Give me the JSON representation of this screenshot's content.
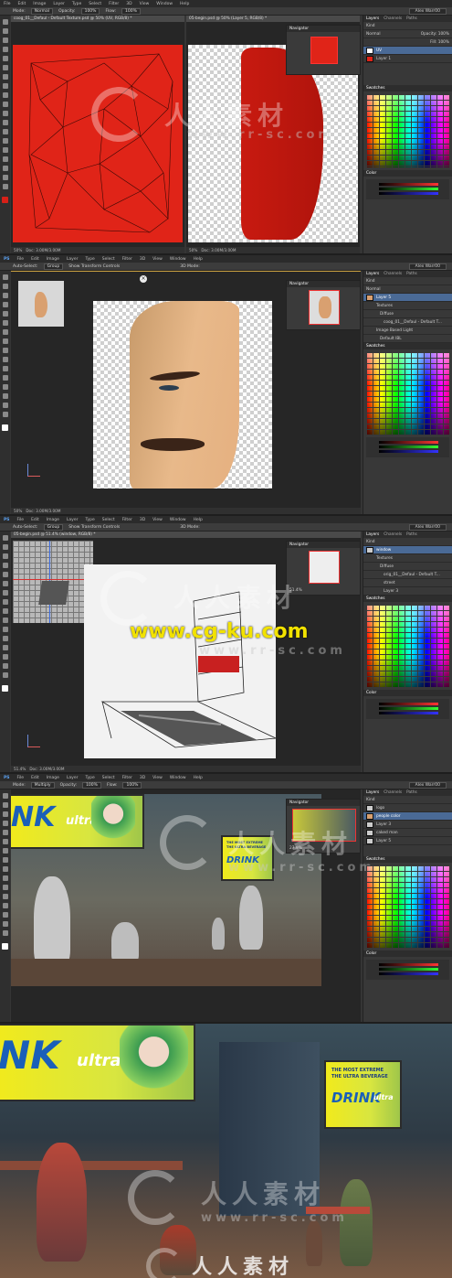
{
  "panel1": {
    "menu": [
      "File",
      "Edit",
      "Image",
      "Layer",
      "Type",
      "Select",
      "Filter",
      "3D",
      "View",
      "Window",
      "Help"
    ],
    "options": {
      "mode_label": "Mode:",
      "mode_value": "Normal",
      "opacity_label": "Opacity:",
      "opacity_value": "100%",
      "flow_label": "Flow:",
      "flow_value": "100%"
    },
    "workspace": "Alex Warr00",
    "doc1_tab": "coog_01__Defaul - Default Texture.psd @ 50% (UV, RGB/8) *",
    "doc2_tab": "05-begin.psd @ 50% (Layer 5, RGB/8) *",
    "doc1_status_zoom": "50%",
    "doc1_status": "Doc: 3.00M/3.00M",
    "doc2_status_zoom": "50%",
    "doc2_status": "Doc: 3.00M/3.00M",
    "navigator": "Navigator",
    "layers_tabs": [
      "Layers",
      "Channels",
      "Paths"
    ],
    "layers_kind": "Kind",
    "layers_blend": "Normal",
    "layers_opacity": "Opacity: 100%",
    "layers_fill": "Fill: 100%",
    "layers": [
      "UV",
      "Layer 1"
    ],
    "swatches_title": "Swatches",
    "color_title": "Color"
  },
  "panel2": {
    "menu": [
      "PS",
      "File",
      "Edit",
      "Image",
      "Layer",
      "Type",
      "Select",
      "Filter",
      "3D",
      "View",
      "Window",
      "Help"
    ],
    "options": {
      "auto_select": "Auto-Select:",
      "group": "Group",
      "show_transform": "Show Transform Controls",
      "mode_3d": "3D Mode:"
    },
    "workspace": "Alex Warr00",
    "status_zoom": "50%",
    "status": "Doc: 3.00M/3.00M",
    "navigator": "Navigator",
    "layers": [
      "Layer 5",
      "Textures",
      "coog_01__Defaul - Default T...",
      "Image Based Light",
      "Default IBL"
    ],
    "layers_sub": "Diffuse",
    "swatches_title": "Swatches"
  },
  "panel3": {
    "menu": [
      "PS",
      "File",
      "Edit",
      "Image",
      "Layer",
      "Type",
      "Select",
      "Filter",
      "3D",
      "View",
      "Window",
      "Help"
    ],
    "options": {
      "auto_select": "Auto-Select:",
      "group": "Group",
      "show_transform": "Show Transform Controls",
      "mode_3d": "3D Mode:"
    },
    "workspace": "Alex Warr00",
    "doc_tab": "05-begin.psd @ 51.4% (window, RGB/8) *",
    "status_zoom": "51.4%",
    "status": "Doc: 3.00M/3.00M",
    "nav_zoom": "51.4%",
    "navigator": "Navigator",
    "layers": [
      "window",
      "Textures",
      "Diffuse",
      "orig_01__Defaul - Default T...",
      "street",
      "Layer 3"
    ],
    "swatches_title": "Swatches",
    "color_title": "Color"
  },
  "panel4": {
    "menu": [
      "PS",
      "File",
      "Edit",
      "Image",
      "Layer",
      "Type",
      "Select",
      "Filter",
      "3D",
      "View",
      "Window",
      "Help"
    ],
    "options": {
      "mode_label": "Mode:",
      "mode_value": "Multiply",
      "opacity_label": "Opacity:",
      "opacity_value": "100%",
      "flow_label": "Flow:",
      "flow_value": "100%"
    },
    "workspace": "Alex Warr00",
    "navigator": "Navigator",
    "nav_zoom": "27.9%",
    "layers": [
      "logo",
      "people color",
      "Layer 3",
      "caked man",
      "Layer 5"
    ],
    "swatches_title": "Swatches",
    "color_title": "Color"
  },
  "art": {
    "billboard_text": "NK",
    "billboard_sub": "ultra",
    "right_bb_line1": "THE MOST EXTREME",
    "right_bb_line2": "THE ULTRA BEVERAGE",
    "right_bb_drink": "DRINK",
    "right_bb_ultra": "ultra"
  },
  "watermarks": {
    "logo_text": "人人素材",
    "url_text": "www.rr-sc.com",
    "yellow_url": "www.cg-ku.com"
  }
}
